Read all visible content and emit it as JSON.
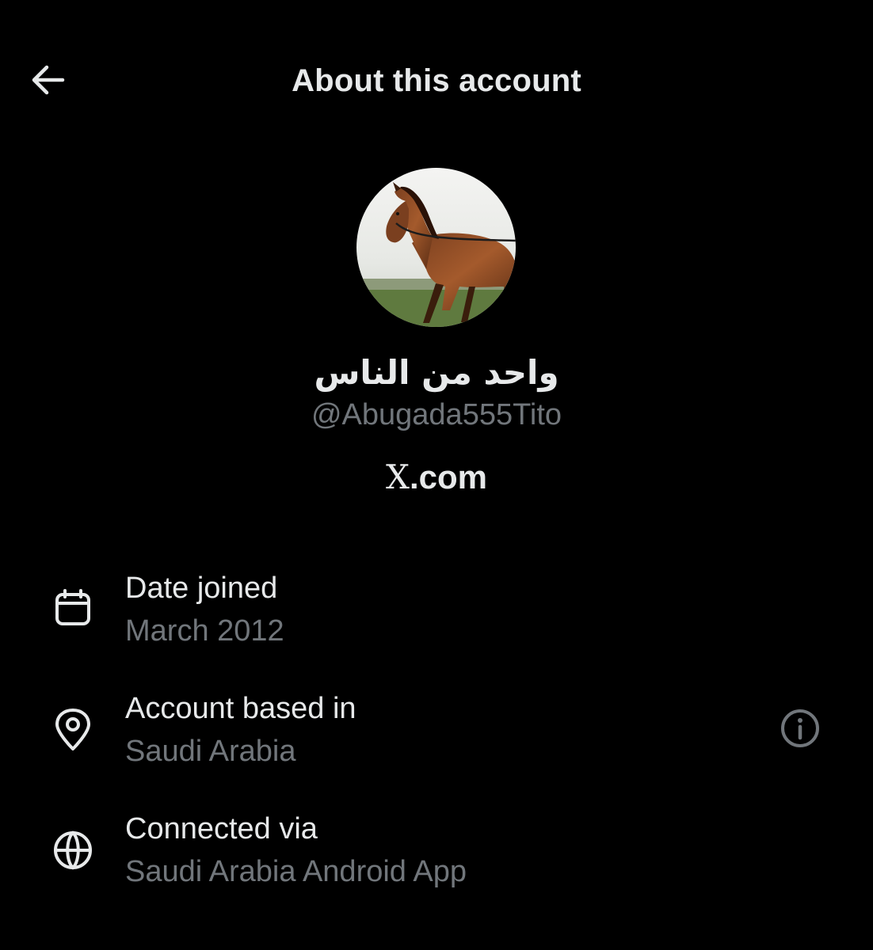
{
  "header": {
    "back_icon": "arrow-left-icon",
    "title": "About this account"
  },
  "profile": {
    "avatar_description": "horse",
    "display_name": "واحد من الناس",
    "handle": "@Abugada555Tito",
    "site_logo": "X",
    "site_suffix": ".com"
  },
  "details": [
    {
      "icon": "calendar-icon",
      "label": "Date joined",
      "value": "March 2012"
    },
    {
      "icon": "location-pin-icon",
      "label": "Account based in",
      "value": "Saudi Arabia",
      "action_icon": "info-icon"
    },
    {
      "icon": "globe-icon",
      "label": "Connected via",
      "value": "Saudi Arabia Android App"
    }
  ],
  "colors": {
    "background": "#000000",
    "primary_text": "#e7e9ea",
    "secondary_text": "#71767b",
    "icon": "#e7e9ea",
    "info_icon": "#71767b"
  }
}
